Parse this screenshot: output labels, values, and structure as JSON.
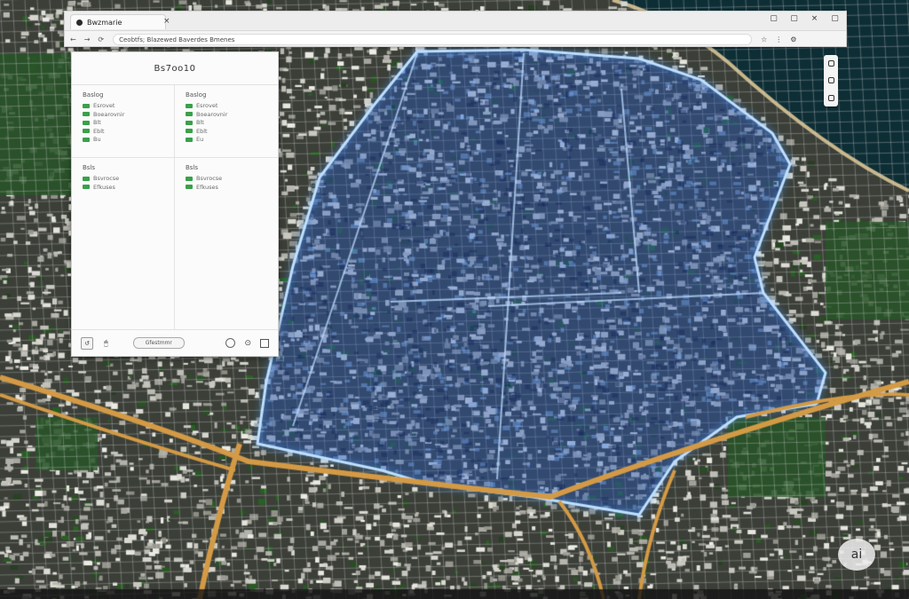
{
  "browser": {
    "tab_title": "Bwzmarie",
    "tab_close": "×",
    "window_buttons": [
      "▢",
      "▢",
      "×",
      "▢"
    ],
    "nav": [
      "←",
      "→",
      "⟳"
    ],
    "address_text": "Ceobtfs; Blazewed Baverdes Bmenes",
    "address_icons": [
      "☆",
      "⋮",
      "⚙"
    ]
  },
  "panel": {
    "title": "Bs7oo10",
    "cells": [
      {
        "title": "Baslog",
        "rows": [
          "Esrovet",
          "Boearovnir",
          "Blt",
          "Eblt",
          "Bu"
        ]
      },
      {
        "title": "Baslog",
        "rows": [
          "Esrovet",
          "Boearovnir",
          "Blt",
          "Eblt",
          "Eu"
        ]
      },
      {
        "title": "Bsls",
        "rows": [
          "Bsvrocse",
          "Efkuses"
        ]
      },
      {
        "title": "Bsls",
        "rows": [
          "Bsvrocse",
          "Efkuses"
        ]
      }
    ],
    "footer": {
      "left_btn": "↺",
      "left_icon": "🖱",
      "center_label": "Gfestmmr"
    }
  },
  "map": {
    "zoom_controls": [
      "zoom-in",
      "zoom-out",
      "layers"
    ],
    "badge": "ai",
    "colors": {
      "highlight": "#4a8ee0",
      "road": "#d49a45",
      "water": "#0e2e36"
    }
  }
}
